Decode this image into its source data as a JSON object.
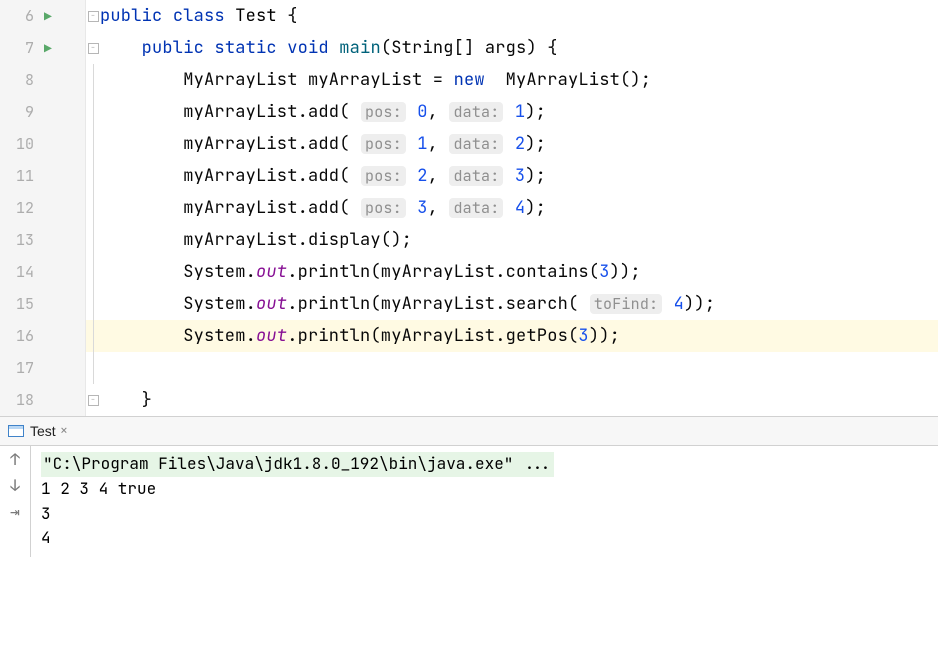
{
  "editor": {
    "highlight_line": 16,
    "lines": [
      {
        "n": 6,
        "run": true,
        "fold": "open",
        "tokens": [
          [
            "kw",
            "public"
          ],
          [
            "plain",
            " "
          ],
          [
            "kw",
            "class"
          ],
          [
            "plain",
            " "
          ],
          [
            "cls",
            "Test"
          ],
          [
            "plain",
            " {"
          ]
        ]
      },
      {
        "n": 7,
        "run": true,
        "fold": "open",
        "tokens": [
          [
            "plain",
            "    "
          ],
          [
            "kw",
            "public"
          ],
          [
            "plain",
            " "
          ],
          [
            "kw",
            "static"
          ],
          [
            "plain",
            " "
          ],
          [
            "kw",
            "void"
          ],
          [
            "plain",
            " "
          ],
          [
            "mname",
            "main"
          ],
          [
            "plain",
            "(String[] args) {"
          ]
        ]
      },
      {
        "n": 8,
        "run": false,
        "fold": "line",
        "tokens": [
          [
            "plain",
            "        MyArrayList myArrayList = "
          ],
          [
            "kw",
            "new"
          ],
          [
            "plain",
            "  MyArrayList();"
          ]
        ]
      },
      {
        "n": 9,
        "run": false,
        "fold": "line",
        "tokens": [
          [
            "plain",
            "        myArrayList.add( "
          ],
          [
            "hint",
            "pos:"
          ],
          [
            "plain",
            " "
          ],
          [
            "num",
            "0"
          ],
          [
            "plain",
            ", "
          ],
          [
            "hint",
            "data:"
          ],
          [
            "plain",
            " "
          ],
          [
            "num",
            "1"
          ],
          [
            "plain",
            ");"
          ]
        ]
      },
      {
        "n": 10,
        "run": false,
        "fold": "line",
        "tokens": [
          [
            "plain",
            "        myArrayList.add( "
          ],
          [
            "hint",
            "pos:"
          ],
          [
            "plain",
            " "
          ],
          [
            "num",
            "1"
          ],
          [
            "plain",
            ", "
          ],
          [
            "hint",
            "data:"
          ],
          [
            "plain",
            " "
          ],
          [
            "num",
            "2"
          ],
          [
            "plain",
            ");"
          ]
        ]
      },
      {
        "n": 11,
        "run": false,
        "fold": "line",
        "tokens": [
          [
            "plain",
            "        myArrayList.add( "
          ],
          [
            "hint",
            "pos:"
          ],
          [
            "plain",
            " "
          ],
          [
            "num",
            "2"
          ],
          [
            "plain",
            ", "
          ],
          [
            "hint",
            "data:"
          ],
          [
            "plain",
            " "
          ],
          [
            "num",
            "3"
          ],
          [
            "plain",
            ");"
          ]
        ]
      },
      {
        "n": 12,
        "run": false,
        "fold": "line",
        "tokens": [
          [
            "plain",
            "        myArrayList.add( "
          ],
          [
            "hint",
            "pos:"
          ],
          [
            "plain",
            " "
          ],
          [
            "num",
            "3"
          ],
          [
            "plain",
            ", "
          ],
          [
            "hint",
            "data:"
          ],
          [
            "plain",
            " "
          ],
          [
            "num",
            "4"
          ],
          [
            "plain",
            ");"
          ]
        ]
      },
      {
        "n": 13,
        "run": false,
        "fold": "line",
        "tokens": [
          [
            "plain",
            "        myArrayList.display();"
          ]
        ]
      },
      {
        "n": 14,
        "run": false,
        "fold": "line",
        "tokens": [
          [
            "plain",
            "        System."
          ],
          [
            "field",
            "out"
          ],
          [
            "plain",
            ".println(myArrayList.contains("
          ],
          [
            "num",
            "3"
          ],
          [
            "plain",
            "));"
          ]
        ]
      },
      {
        "n": 15,
        "run": false,
        "fold": "line",
        "tokens": [
          [
            "plain",
            "        System."
          ],
          [
            "field",
            "out"
          ],
          [
            "plain",
            ".println(myArrayList.search( "
          ],
          [
            "hint",
            "toFind:"
          ],
          [
            "plain",
            " "
          ],
          [
            "num",
            "4"
          ],
          [
            "plain",
            "));"
          ]
        ]
      },
      {
        "n": 16,
        "run": false,
        "fold": "line",
        "tokens": [
          [
            "plain",
            "        System."
          ],
          [
            "field",
            "out"
          ],
          [
            "plain",
            ".println(myArrayList.getPos("
          ],
          [
            "num",
            "3"
          ],
          [
            "plain",
            "));"
          ]
        ]
      },
      {
        "n": 17,
        "run": false,
        "fold": "line",
        "tokens": [
          [
            "plain",
            ""
          ]
        ]
      },
      {
        "n": 18,
        "run": false,
        "fold": "close",
        "tokens": [
          [
            "plain",
            "    }"
          ]
        ]
      }
    ]
  },
  "run_tab": {
    "label": "Test",
    "close": "×"
  },
  "toolbar": {
    "up": "↑",
    "down": "↓",
    "wrap": "⇥"
  },
  "output": {
    "cmd": "\"C:\\Program Files\\Java\\jdk1.8.0_192\\bin\\java.exe\" ...",
    "lines": [
      "1 2 3 4 true",
      "3",
      "4"
    ]
  }
}
